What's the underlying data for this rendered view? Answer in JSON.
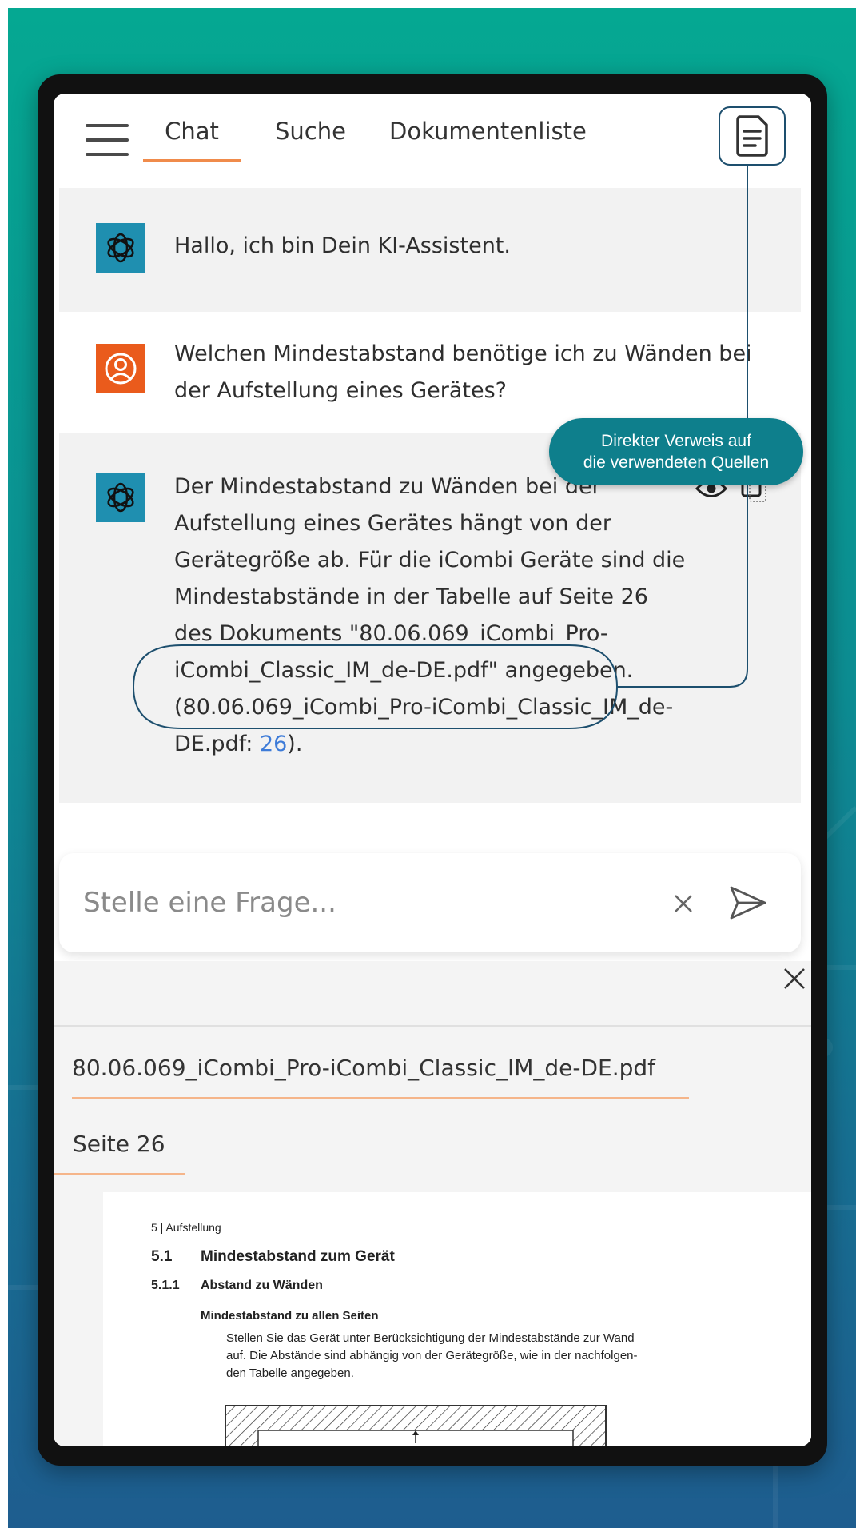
{
  "header": {
    "tabs": [
      {
        "label": "Chat",
        "active": true
      },
      {
        "label": "Suche",
        "active": false
      },
      {
        "label": "Dokumentenliste",
        "active": false
      }
    ]
  },
  "messages": {
    "greeting": "Hallo, ich bin Dein KI-Assistent.",
    "question_line1": "Welchen Mindestabstand benötige ich zu Wänden bei",
    "question_line2": "der Aufstellung eines Gerätes?",
    "answer_lines": [
      "Der Mindestabstand zu Wänden bei der",
      "Aufstellung eines Gerätes hängt von der",
      "Gerätegröße ab. Für die iCombi Geräte sind die",
      "Mindestabstände in der Tabelle auf Seite 26",
      "des Dokuments \"80.06.069_iCombi_Pro-",
      "iCombi_Classic_IM_de-DE.pdf\" angegeben.",
      "(80.06.069_iCombi_Pro-iCombi_Classic_IM_de-"
    ],
    "citation_prefix": "DE.pdf: ",
    "citation_page": "26",
    "citation_suffix": ")."
  },
  "tooltip": {
    "line1": "Direkter Verweis auf",
    "line2": "die verwendeten Quellen"
  },
  "input": {
    "placeholder": "Stelle eine Frage..."
  },
  "source_panel": {
    "document_tab": "80.06.069_iCombi_Pro-iCombi_Classic_IM_de-DE.pdf",
    "page_tab": "Seite 26",
    "preview": {
      "section_header": "5 | Aufstellung",
      "h1_num": "5.1",
      "h1_title": "Mindestabstand zum Gerät",
      "h2_num": "5.1.1",
      "h2_title": "Abstand zu Wänden",
      "h3_title": "Mindestabstand zu allen Seiten",
      "body_lines": [
        "Stellen Sie das Gerät unter Berücksichtigung der Mindestabstände zur Wand",
        "auf. Die Abstände sind abhängig von der Gerätegröße, wie in der nachfolgen-",
        "den Tabelle angegeben."
      ]
    }
  },
  "colors": {
    "accent_orange": "#f08b4b",
    "bot_avatar": "#1f8fb0",
    "user_avatar": "#ea5b1c",
    "callout_line": "#1d4f6e",
    "tooltip_bg": "#0e7f8c",
    "link": "#3d7bd8"
  }
}
